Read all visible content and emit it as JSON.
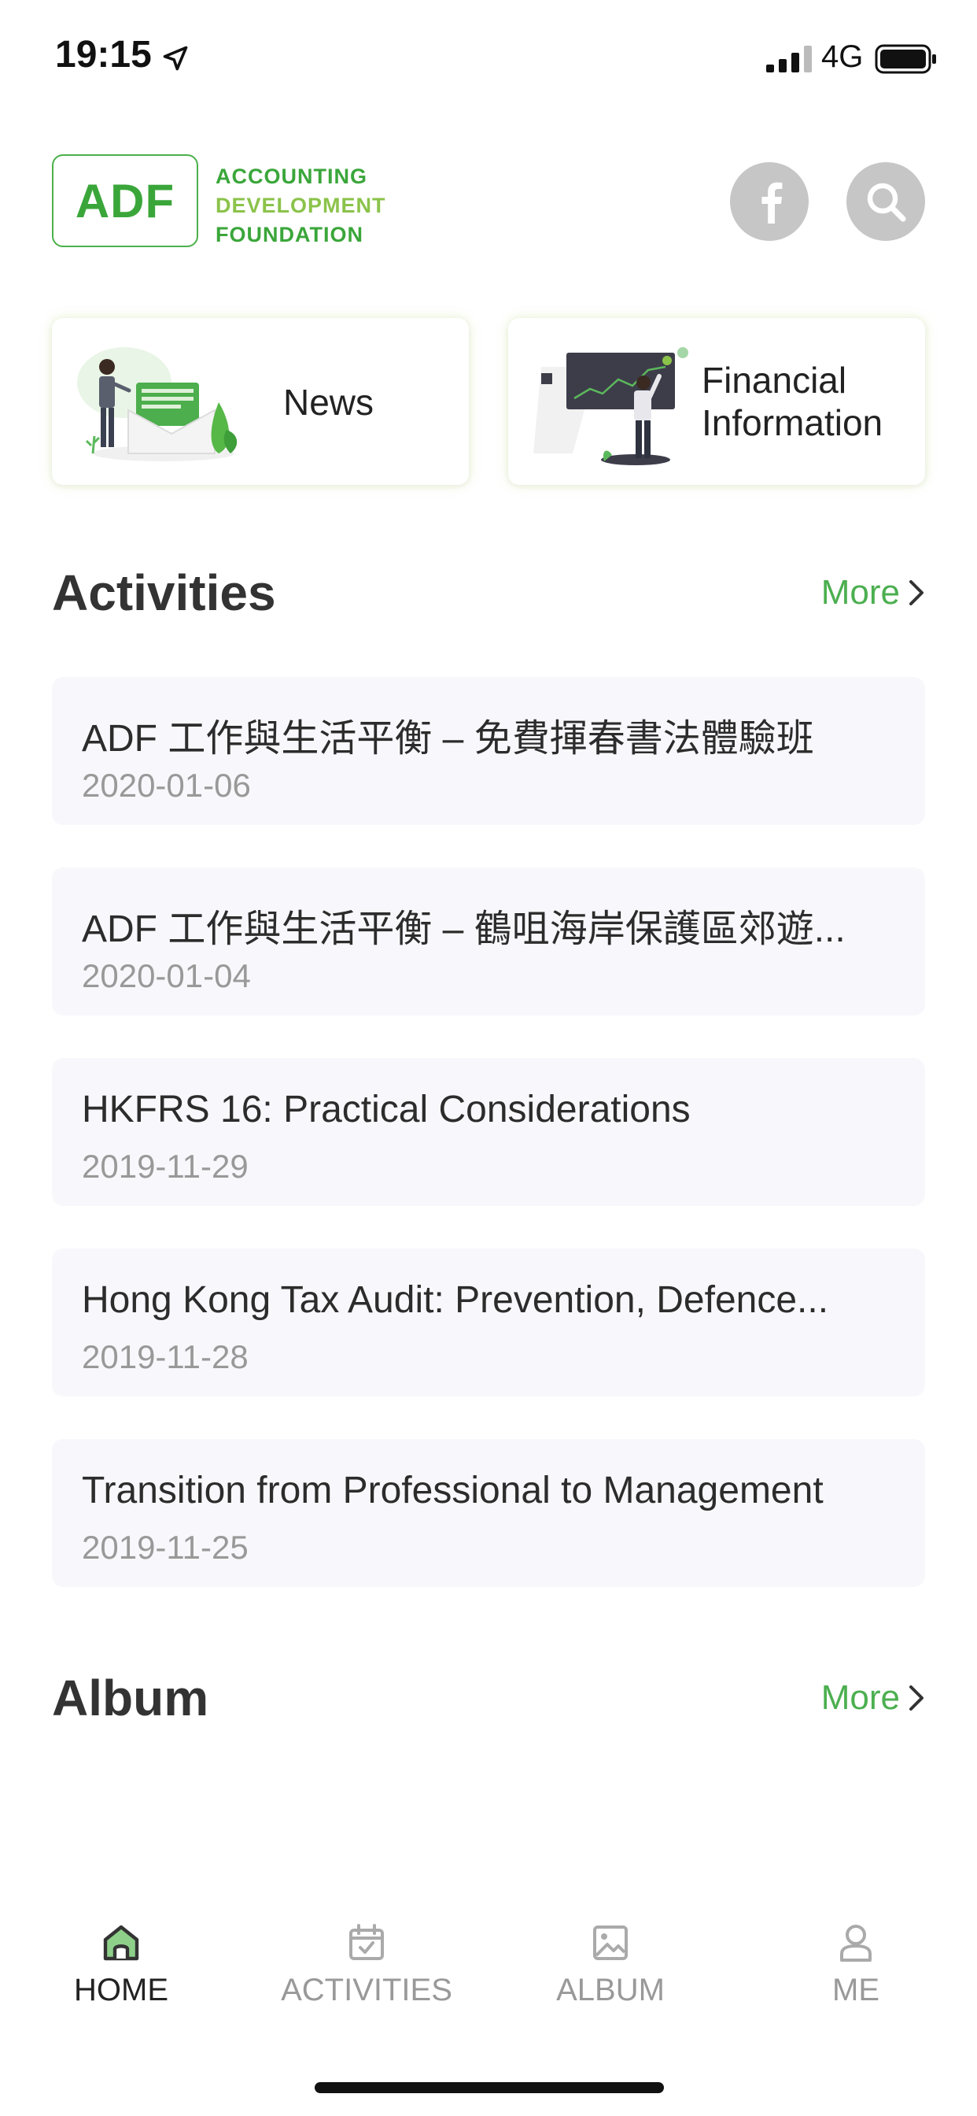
{
  "status_bar": {
    "time": "19:15",
    "network": "4G"
  },
  "header": {
    "logo": {
      "abbr": "ADF",
      "line1": "ACCOUNTING",
      "line2": "DEVELOPMENT",
      "line3": "FOUNDATION"
    },
    "facebook_icon": "facebook-icon",
    "search_icon": "search-icon"
  },
  "quick_links": [
    {
      "label": "News",
      "icon": "news-illustration"
    },
    {
      "label": "Financial Information",
      "icon": "financial-illustration"
    }
  ],
  "activities": {
    "title": "Activities",
    "more_label": "More",
    "items": [
      {
        "title": "ADF 工作與生活平衡 – 免費揮春書法體驗班",
        "date": "2020-01-06"
      },
      {
        "title": "ADF 工作與生活平衡 – 鶴咀海岸保護區郊遊...",
        "date": "2020-01-04"
      },
      {
        "title": "HKFRS 16: Practical Considerations",
        "date": "2019-11-29"
      },
      {
        "title": "Hong Kong Tax Audit: Prevention, Defence...",
        "date": "2019-11-28"
      },
      {
        "title": "Transition from Professional to Management",
        "date": "2019-11-25"
      }
    ]
  },
  "album": {
    "title": "Album",
    "more_label": "More"
  },
  "tab_bar": {
    "tabs": [
      {
        "label": "HOME",
        "icon": "home-icon",
        "active": true
      },
      {
        "label": "ACTIVITIES",
        "icon": "calendar-icon",
        "active": false
      },
      {
        "label": "ALBUM",
        "icon": "image-icon",
        "active": false
      },
      {
        "label": "ME",
        "icon": "user-icon",
        "active": false
      }
    ]
  },
  "colors": {
    "brand_green": "#4caf50",
    "logo_light_green": "#8bc34a",
    "card_bg": "#f8f8fc",
    "muted": "#999999"
  }
}
